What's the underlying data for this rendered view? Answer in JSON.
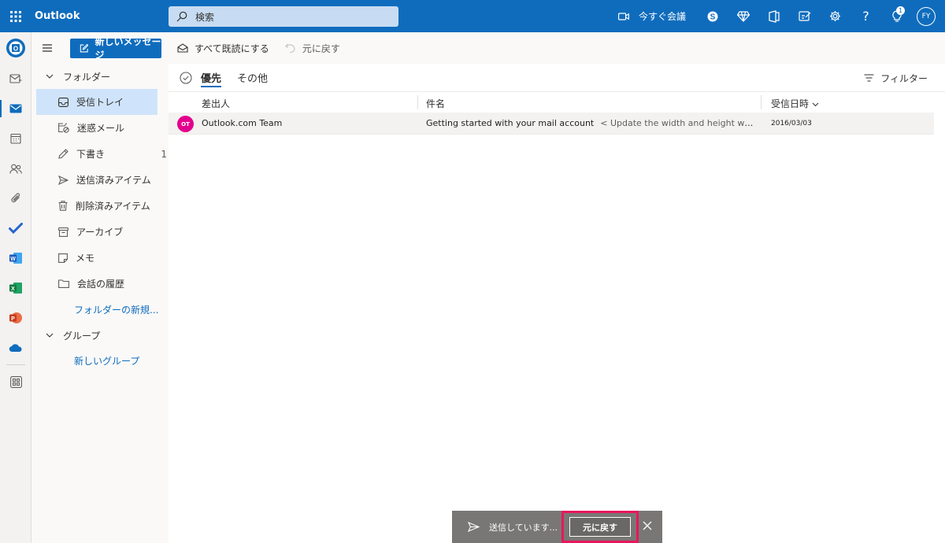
{
  "app": {
    "title": "Outlook"
  },
  "search": {
    "placeholder": "検索"
  },
  "topbar": {
    "meet_now": "今すぐ会議",
    "help": "?",
    "whats_new_badge": "1",
    "user_initials": "FY"
  },
  "command_bar": {
    "new_message": "新しいメッセージ",
    "mark_all_read": "すべて既読にする",
    "undo": "元に戻す"
  },
  "folders": {
    "header": "フォルダー",
    "items": [
      {
        "label": "受信トレイ",
        "count": "",
        "icon": "inbox-icon",
        "selected": true
      },
      {
        "label": "迷惑メール",
        "count": "",
        "icon": "junk-icon",
        "selected": false
      },
      {
        "label": "下書き",
        "count": "1",
        "icon": "draft-icon",
        "selected": false
      },
      {
        "label": "送信済みアイテム",
        "count": "",
        "icon": "sent-icon",
        "selected": false
      },
      {
        "label": "削除済みアイテム",
        "count": "",
        "icon": "trash-icon",
        "selected": false
      },
      {
        "label": "アーカイブ",
        "count": "",
        "icon": "archive-icon",
        "selected": false
      },
      {
        "label": "メモ",
        "count": "",
        "icon": "note-icon",
        "selected": false
      },
      {
        "label": "会話の履歴",
        "count": "",
        "icon": "folder-icon",
        "selected": false
      }
    ],
    "new_folder": "フォルダーの新規...",
    "groups_header": "グループ",
    "new_group": "新しいグループ"
  },
  "message_list": {
    "tabs": [
      {
        "label": "優先",
        "active": true
      },
      {
        "label": "その他",
        "active": false
      }
    ],
    "filter": "フィルター",
    "columns": {
      "from": "差出人",
      "subject": "件名",
      "received": "受信日時"
    },
    "messages": [
      {
        "avatar_initials": "OT",
        "avatar_color": "#e3008c",
        "from": "Outlook.com Team",
        "subject": "Getting started with your mail account",
        "preview": "< Update the width and height when th...",
        "date": "2016/03/03"
      }
    ]
  },
  "toast": {
    "status": "送信しています...",
    "undo": "元に戻す"
  },
  "colors": {
    "brand": "#0f6cbd",
    "highlight": "#e8175d",
    "toast_bg": "#797775"
  }
}
